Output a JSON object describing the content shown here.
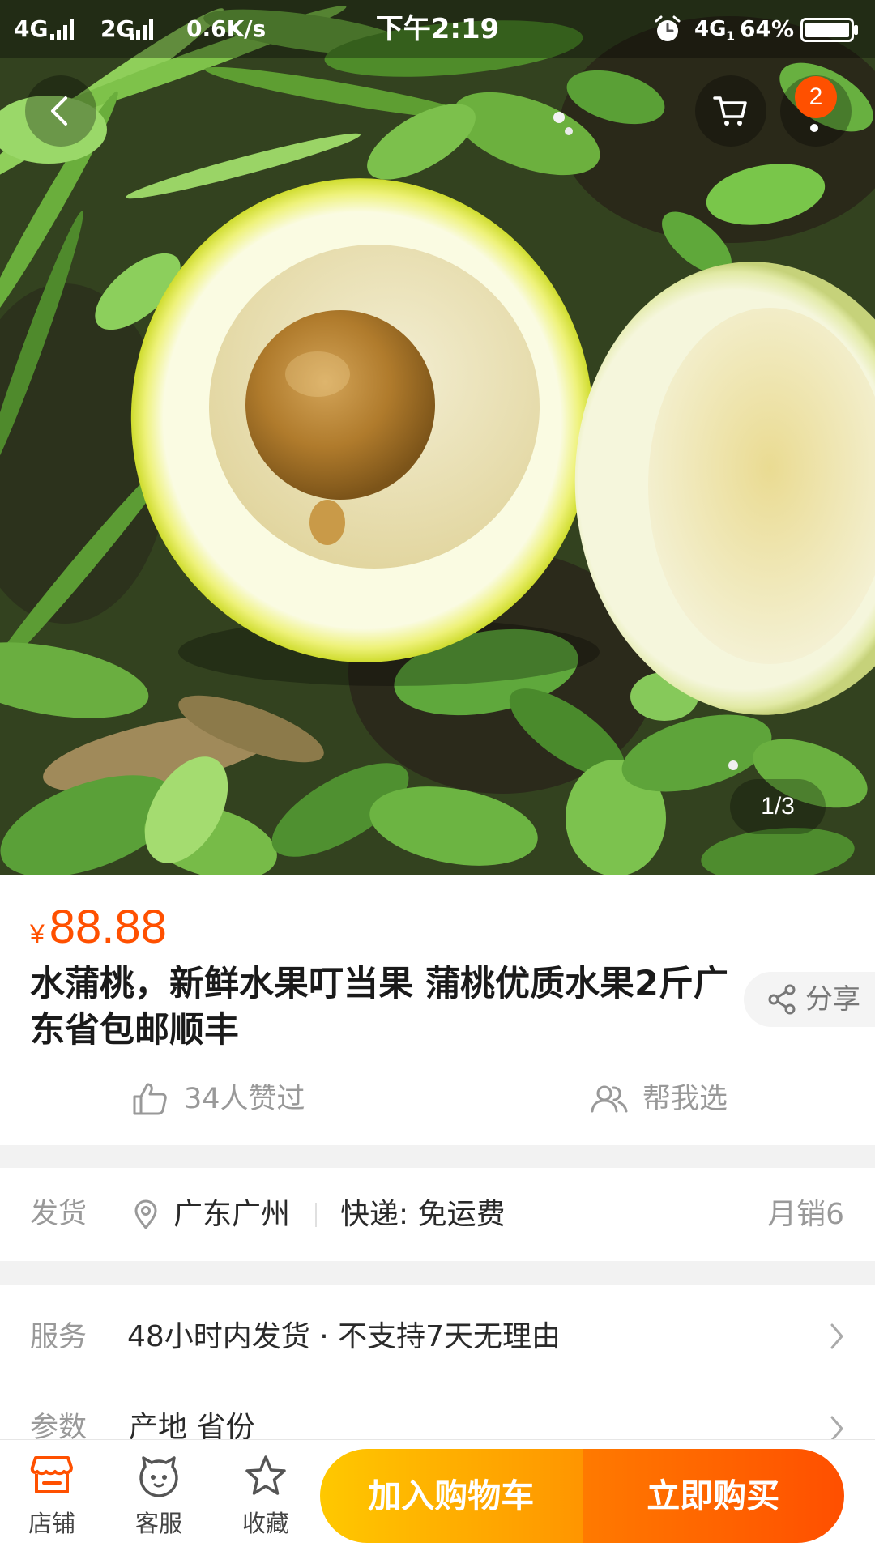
{
  "status_bar": {
    "network_1": "4G",
    "network_2": "2G",
    "speed": "0.6K/s",
    "time": "下午2:19",
    "network_3": "4G",
    "network_3_sim": "1",
    "battery": "64%"
  },
  "header": {
    "cart_badge": "2"
  },
  "gallery": {
    "counter": "1/3"
  },
  "product": {
    "currency": "¥",
    "price": "88.88",
    "title": "水蒲桃，新鲜水果叮当果 蒲桃优质水果2斤广东省包邮顺丰",
    "share_label": "分享",
    "likes": "34人赞过",
    "help_choose": "帮我选"
  },
  "shipping": {
    "label": "发货",
    "location": "广东广州",
    "express": "快递: 免运费",
    "monthly_sales": "月销6"
  },
  "service": {
    "label": "服务",
    "value": "48小时内发货 · 不支持7天无理由"
  },
  "params": {
    "label": "参数",
    "value": "产地 省份"
  },
  "bottom_bar": {
    "store_label": "店铺",
    "support_label": "客服",
    "favorite_label": "收藏",
    "add_to_cart_label": "加入购物车",
    "buy_now_label": "立即购买"
  },
  "icons": {
    "back": "chevron-left-icon",
    "cart": "cart-icon",
    "more": "more-icon",
    "share": "share-icon",
    "likes": "thumbs-up-icon",
    "help_choose": "people-icon",
    "location": "location-pin-icon",
    "row_arrow": "chevron-right-icon",
    "store": "store-icon",
    "support": "customer-service-icon",
    "favorite": "star-icon"
  },
  "colors": {
    "accent": "#ff5000",
    "add_to_cart_start": "#ffc800",
    "add_to_cart_end": "#ff9500",
    "buy_now_start": "#ff7a00",
    "buy_now_end": "#ff4f00",
    "label_gray": "#999999",
    "section_divider": "#f2f2f2"
  }
}
